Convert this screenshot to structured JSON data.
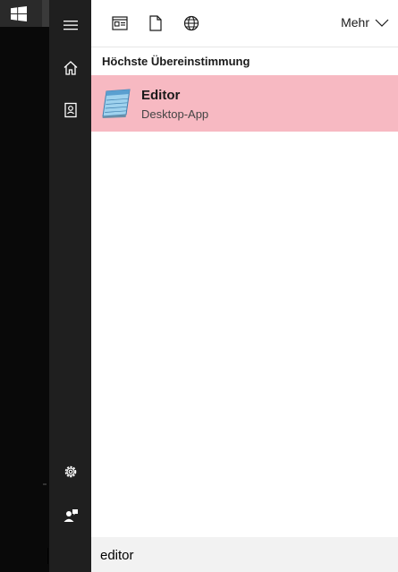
{
  "toolbar": {
    "filters": [
      {
        "icon": "apps-filter-icon"
      },
      {
        "icon": "documents-filter-icon"
      },
      {
        "icon": "web-filter-icon"
      }
    ],
    "more_label": "Mehr"
  },
  "rail": {
    "top_icons": [
      "hamburger-menu-icon",
      "home-icon",
      "notebook-icon"
    ],
    "bottom_icons": [
      "settings-icon",
      "feedback-icon"
    ]
  },
  "results": {
    "best_match_heading": "Höchste Übereinstimmung",
    "items": [
      {
        "title": "Editor",
        "subtitle": "Desktop-App",
        "icon": "notepad-icon"
      }
    ]
  },
  "search": {
    "value": "editor"
  },
  "colors": {
    "selection": "#f7b9c2",
    "rail": "#1f1f1f",
    "panel": "#ffffff",
    "search_box": "#f2f2f2"
  }
}
